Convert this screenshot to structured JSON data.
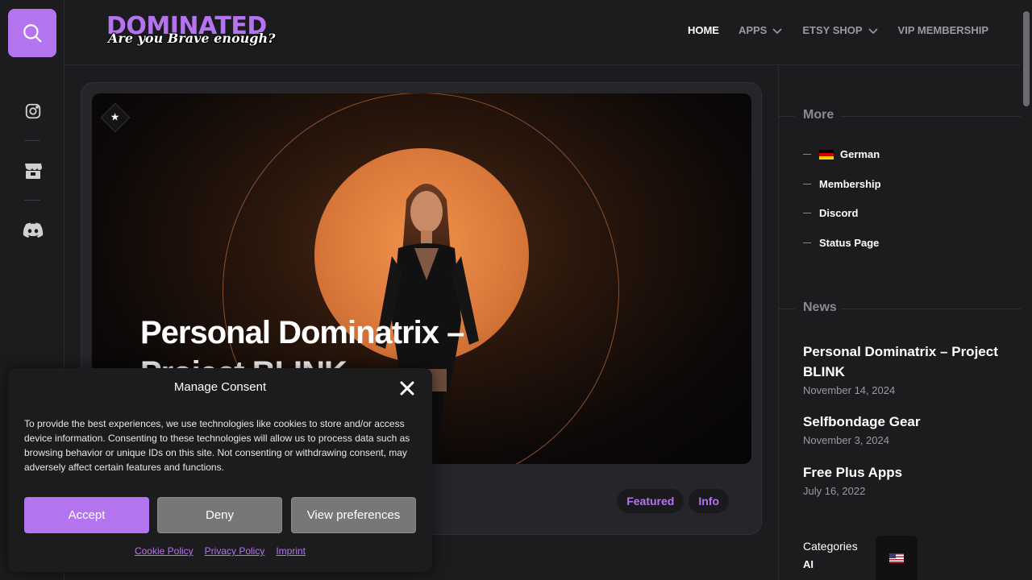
{
  "brand": {
    "name": "DOMINATED",
    "tagline": "Are you Brave enough?",
    "accent_color": "#b574ef"
  },
  "rail": {
    "icons": [
      "search-icon",
      "instagram-icon",
      "etsy-shop-icon",
      "discord-icon"
    ]
  },
  "nav": {
    "items": [
      {
        "label": "HOME",
        "active": true,
        "dropdown": false
      },
      {
        "label": "APPS",
        "active": false,
        "dropdown": true
      },
      {
        "label": "ETSY SHOP",
        "active": false,
        "dropdown": true
      },
      {
        "label": "VIP MEMBERSHIP",
        "active": false,
        "dropdown": false
      }
    ]
  },
  "featured": {
    "title": "Personal Dominatrix – Project BLINK",
    "badge_icon": "star-icon",
    "tags": [
      "Featured",
      "Info"
    ]
  },
  "sidebar": {
    "more": {
      "title": "More",
      "items": [
        {
          "label": "German",
          "icon": "germany-flag-icon"
        },
        {
          "label": "Membership"
        },
        {
          "label": "Discord"
        },
        {
          "label": "Status Page"
        }
      ]
    },
    "news": {
      "title": "News",
      "items": [
        {
          "title": "Personal Dominatrix – Project BLINK",
          "date": "November 14, 2024"
        },
        {
          "title": "Selfbondage Gear",
          "date": "November 3, 2024"
        },
        {
          "title": "Free Plus Apps",
          "date": "July 16, 2022"
        }
      ]
    },
    "categories": {
      "title": "Categories",
      "first_item": "AI"
    },
    "language_switcher_icon": "us-flag-icon"
  },
  "consent": {
    "title": "Manage Consent",
    "text": "To provide the best experiences, we use technologies like cookies to store and/or access device information. Consenting to these technologies will allow us to process data such as browsing behavior or unique IDs on this site. Not consenting or withdrawing consent, may adversely affect certain features and functions.",
    "buttons": {
      "accept": "Accept",
      "deny": "Deny",
      "preferences": "View preferences"
    },
    "links": [
      "Cookie Policy",
      "Privacy Policy",
      "Imprint"
    ]
  }
}
